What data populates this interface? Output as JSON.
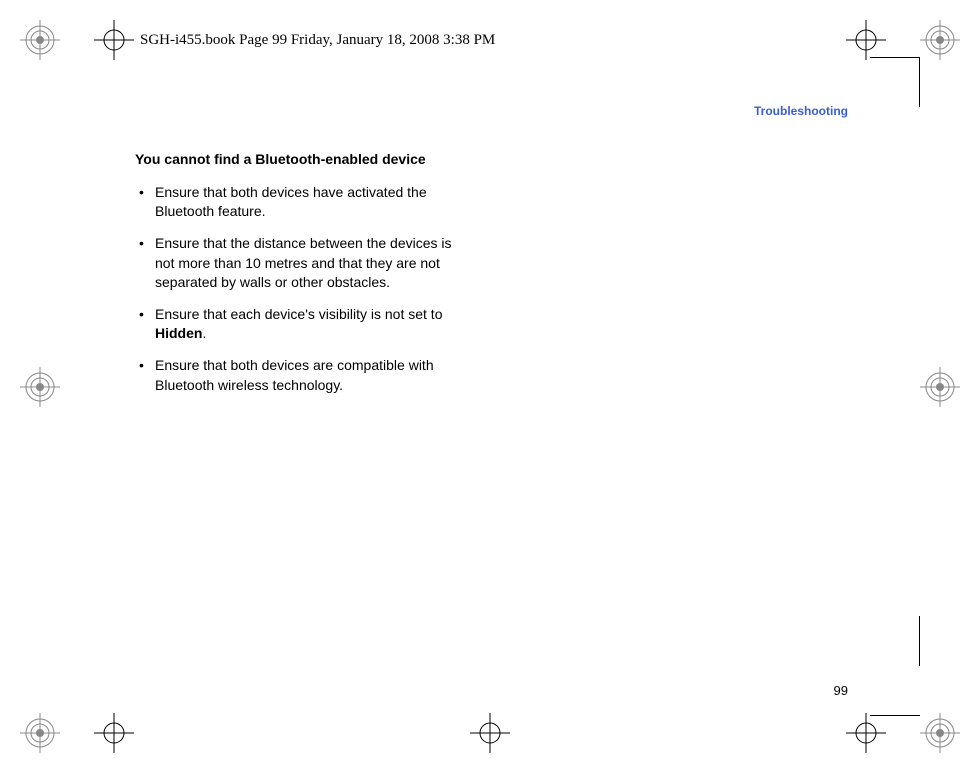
{
  "header": {
    "text": "SGH-i455.book  Page 99  Friday, January 18, 2008  3:38 PM"
  },
  "section_header": "Troubleshooting",
  "content": {
    "subheading": "You cannot find a Bluetooth-enabled device",
    "bullets": [
      "Ensure that both devices have activated the Bluetooth feature.",
      "Ensure that the distance between the devices is not more than 10 metres and that they are not separated by walls or other obstacles.",
      "",
      "Ensure that both devices are compatible with Bluetooth wireless technology."
    ],
    "bullet3_prefix": "Ensure that each device's visibility is not set to ",
    "bullet3_bold": "Hidden",
    "bullet3_suffix": "."
  },
  "page_number": "99"
}
